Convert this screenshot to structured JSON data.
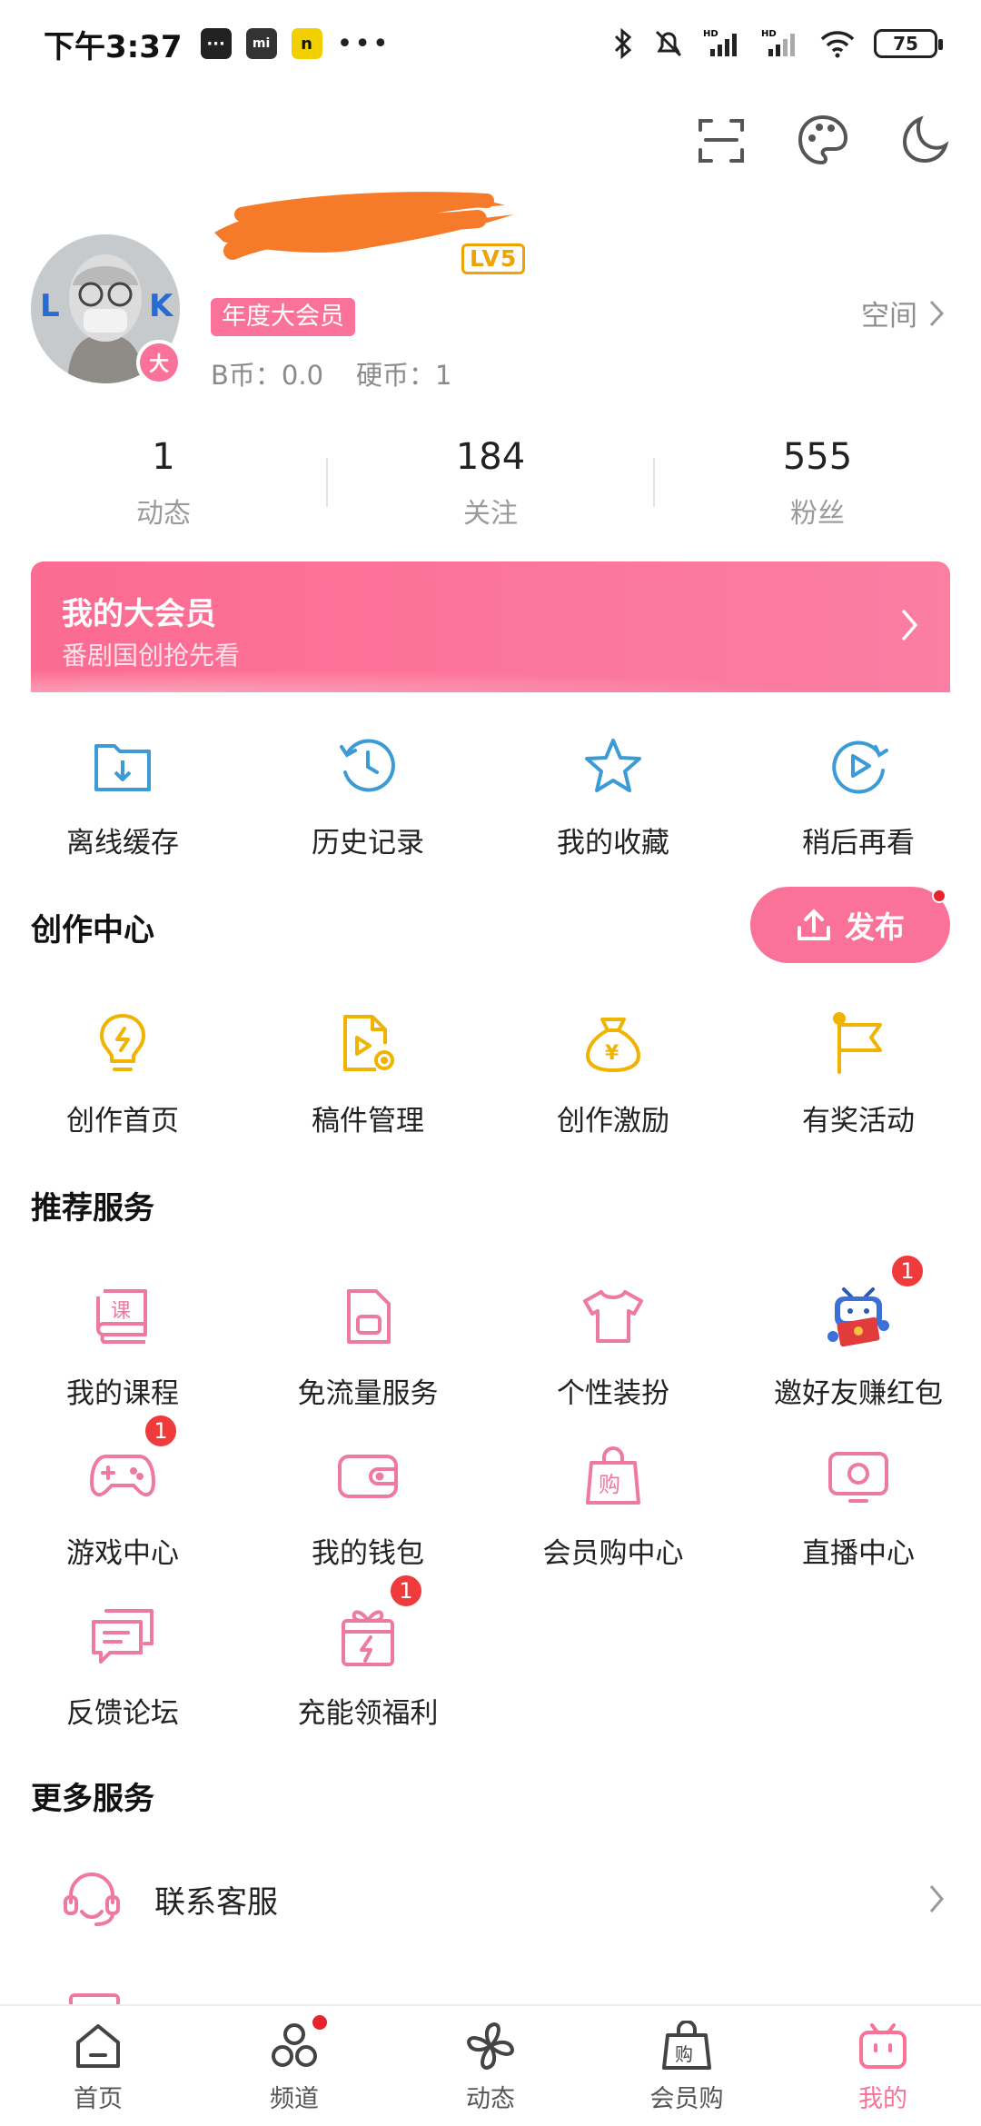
{
  "status_bar": {
    "time": "下午3:37",
    "left_icons": [
      "message-icon",
      "mi-icon",
      "n-app-icon",
      "more-dots-icon"
    ],
    "right_icons": [
      "bluetooth-icon",
      "mute-icon",
      "signal-hd-icon",
      "signal-hd-icon",
      "wifi-icon",
      "battery-icon"
    ],
    "battery_level": "75"
  },
  "top_actions": [
    "scan-icon",
    "palette-icon",
    "night-mode-icon"
  ],
  "profile": {
    "level": "LV5",
    "vip_tag": "年度大会员",
    "vip_badge": "大",
    "bcoin": "B币：0.0",
    "coin": "硬币：1",
    "space_label": "空间"
  },
  "stats": [
    {
      "value": "1",
      "label": "动态"
    },
    {
      "value": "184",
      "label": "关注"
    },
    {
      "value": "555",
      "label": "粉丝"
    }
  ],
  "vip_banner": {
    "title": "我的大会员",
    "subtitle": "番剧国创抢先看"
  },
  "quick_actions": [
    {
      "label": "离线缓存",
      "icon": "download-folder-icon"
    },
    {
      "label": "历史记录",
      "icon": "history-clock-icon"
    },
    {
      "label": "我的收藏",
      "icon": "star-icon"
    },
    {
      "label": "稍后再看",
      "icon": "watch-later-icon"
    }
  ],
  "creation_center": {
    "title": "创作中心",
    "publish_label": "发布",
    "items": [
      {
        "label": "创作首页",
        "icon": "lightbulb-icon"
      },
      {
        "label": "稿件管理",
        "icon": "manuscript-icon"
      },
      {
        "label": "创作激励",
        "icon": "money-bag-icon"
      },
      {
        "label": "有奖活动",
        "icon": "flag-icon"
      }
    ]
  },
  "recommended": {
    "title": "推荐服务",
    "items": [
      {
        "label": "我的课程",
        "icon": "course-book-icon",
        "badge": ""
      },
      {
        "label": "免流量服务",
        "icon": "sim-card-icon",
        "badge": ""
      },
      {
        "label": "个性装扮",
        "icon": "tshirt-icon",
        "badge": ""
      },
      {
        "label": "邀好友赚红包",
        "icon": "tv-mascot-icon",
        "badge": "1"
      },
      {
        "label": "游戏中心",
        "icon": "gamepad-icon",
        "badge": "1"
      },
      {
        "label": "我的钱包",
        "icon": "wallet-icon",
        "badge": ""
      },
      {
        "label": "会员购中心",
        "icon": "shopping-bag-icon",
        "badge": ""
      },
      {
        "label": "直播中心",
        "icon": "live-tv-icon",
        "badge": ""
      },
      {
        "label": "反馈论坛",
        "icon": "chat-bubbles-icon",
        "badge": ""
      },
      {
        "label": "充能领福利",
        "icon": "gift-bolt-icon",
        "badge": "1"
      }
    ]
  },
  "more_services": {
    "title": "更多服务",
    "items": [
      {
        "label": "联系客服",
        "icon": "headset-icon"
      }
    ]
  },
  "bottom_nav": [
    {
      "label": "首页",
      "icon": "home-icon",
      "active": false,
      "dot": false
    },
    {
      "label": "频道",
      "icon": "channel-icon",
      "active": false,
      "dot": true
    },
    {
      "label": "动态",
      "icon": "pinwheel-icon",
      "active": false,
      "dot": false
    },
    {
      "label": "会员购",
      "icon": "shop-bag-icon",
      "active": false,
      "dot": false
    },
    {
      "label": "我的",
      "icon": "tv-icon",
      "active": true,
      "dot": false
    }
  ],
  "colors": {
    "accent_pink": "#fb7299",
    "icon_blue": "#3a9bd6",
    "icon_yellow": "#f0b400",
    "badge_red": "#ef3b3b"
  }
}
